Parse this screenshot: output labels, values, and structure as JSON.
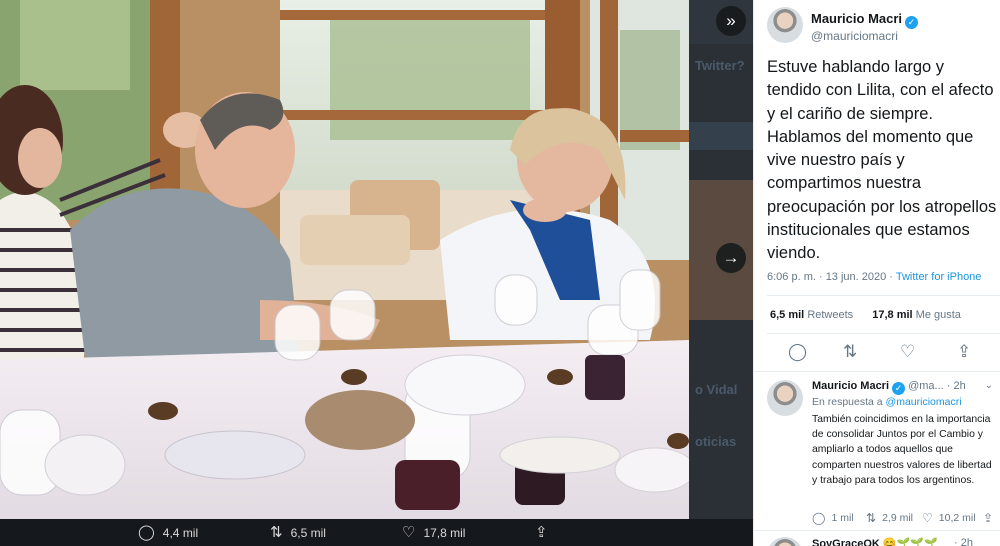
{
  "media": {
    "nav_next_top": "»",
    "nav_next_right": "→",
    "background_snippets": [
      "Twitter?",
      "o Vidal",
      "oticias"
    ],
    "actions": {
      "reply_count": "4,4 mil",
      "retweet_count": "6,5 mil",
      "like_count": "17,8 mil"
    },
    "icons": {
      "reply": "comment-icon",
      "retweet": "retweet-icon",
      "like": "heart-icon",
      "share": "share-icon"
    }
  },
  "tweet": {
    "author": {
      "name": "Mauricio Macri",
      "handle": "@mauriciomacri",
      "verified": "✓"
    },
    "text": "Estuve hablando largo y tendido con Lilita, con el afecto y el cariño de siempre. Hablamos del momento que vive nuestro país y compartimos nuestra preocupación por los atropellos institucionales que estamos viendo.",
    "timestamp": "6:06 p. m. · 13 jun. 2020 · ",
    "source": "Twitter for iPhone",
    "retweets": {
      "count": "6,5 mil",
      "label": "Retweets"
    },
    "likes": {
      "count": "17,8 mil",
      "label": "Me gusta"
    }
  },
  "reply": {
    "author": {
      "name": "Mauricio Macri",
      "handle": "@ma...",
      "time": "· 2h"
    },
    "in_reply_prefix": "En respuesta a ",
    "in_reply_to": "@mauriciomacri",
    "text": "También coincidimos en la importancia de consolidar Juntos por el Cambio y ampliarlo a todos aquellos que comparten nuestros valores de libertad y trabajo para todos los argentinos.",
    "reply_count": "1 mil",
    "retweet_count": "2,9 mil",
    "like_count": "10,2 mil"
  },
  "next_reply": {
    "name": "SoyGraceOK 😊🌱🌱🌱",
    "time": "· 2h"
  },
  "colors": {
    "link": "#1b95e0",
    "verified": "#1da1f2",
    "muted": "#657786",
    "viewer_bg": "#15181c"
  }
}
